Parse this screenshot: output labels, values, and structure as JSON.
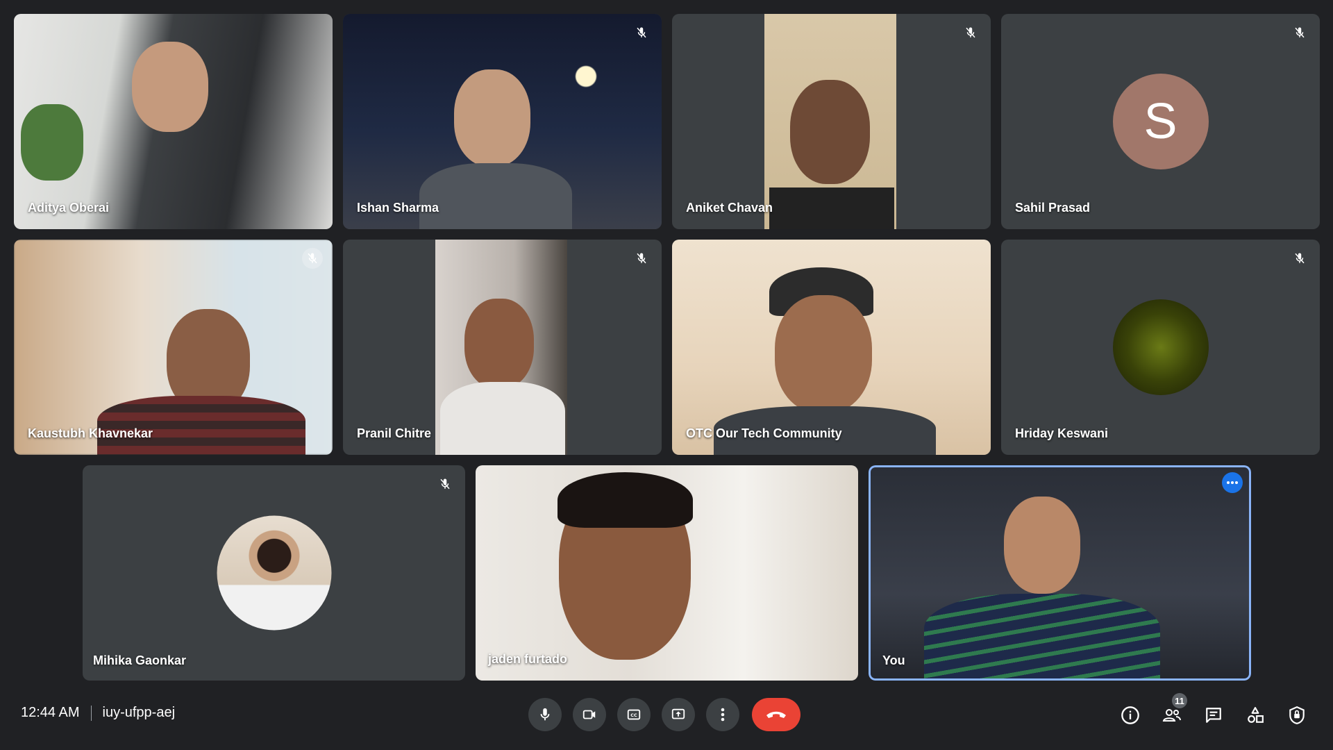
{
  "participants": [
    {
      "name": "Aditya Oberai",
      "muted": false
    },
    {
      "name": "Ishan Sharma",
      "muted": true
    },
    {
      "name": "Aniket Chavan",
      "muted": true
    },
    {
      "name": "Sahil Prasad",
      "muted": true,
      "avatar_letter": "S"
    },
    {
      "name": "Kaustubh Khavnekar",
      "muted": true
    },
    {
      "name": "Pranil Chitre",
      "muted": true
    },
    {
      "name": "OTC Our Tech Community",
      "muted": false
    },
    {
      "name": "Hriday Keswani",
      "muted": true
    },
    {
      "name": "Mihika Gaonkar",
      "muted": true
    },
    {
      "name": "jaden furtado",
      "muted": false
    },
    {
      "name": "You",
      "muted": false
    }
  ],
  "meeting": {
    "time": "12:44 AM",
    "code": "iuy-ufpp-aej"
  },
  "toolbar": {
    "people_count": "11"
  },
  "colors": {
    "background": "#202124",
    "tile": "#3c4043",
    "hangup": "#ea4335",
    "self_border": "#8ab4f8",
    "accent": "#1a73e8"
  },
  "icons": [
    "mic-off-icon",
    "mic-icon",
    "camera-icon",
    "captions-icon",
    "present-icon",
    "more-vert-icon",
    "hangup-icon",
    "info-icon",
    "people-icon",
    "chat-icon",
    "activities-icon",
    "host-controls-icon"
  ]
}
